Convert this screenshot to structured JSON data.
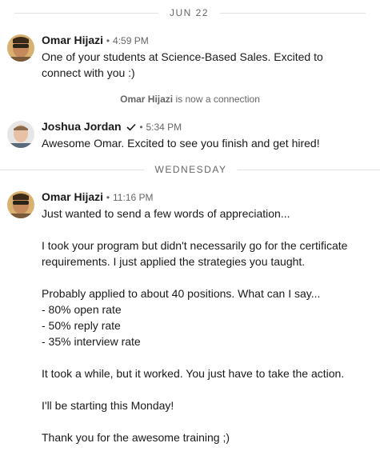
{
  "dividers": {
    "date1": "JUN 22",
    "date2": "WEDNESDAY"
  },
  "messages": [
    {
      "sender": "Omar Hijazi",
      "bullet": "•",
      "time": "4:59 PM",
      "body": "One of your students at Science-Based Sales. Excited to\nconnect with you :)"
    },
    {
      "sender": "Joshua Jordan",
      "bullet": "•",
      "time": "5:34 PM",
      "body": "Awesome Omar. Excited to see you finish and get hired!"
    },
    {
      "sender": "Omar Hijazi",
      "bullet": "•",
      "time": "11:16 PM",
      "body": "Just wanted to send a few words of appreciation...\n\nI took your program but didn't necessarily go for the certificate\nrequirements. I just applied the strategies you taught.\n\nProbably applied to about 40 positions. What can I say...\n- 80% open rate\n- 50% reply rate\n- 35% interview rate\n\nIt took a while, but it worked. You just have to take the action.\n\nI'll be starting this Monday!\n\nThank you for the awesome training ;)"
    }
  ],
  "system_notice": {
    "name": "Omar Hijazi",
    "text": " is now a connection"
  },
  "icons": {
    "verified": "checkmark-icon"
  },
  "colors": {
    "text": "#1a1a1a",
    "muted": "#666666",
    "divider": "#e1e1e1"
  }
}
